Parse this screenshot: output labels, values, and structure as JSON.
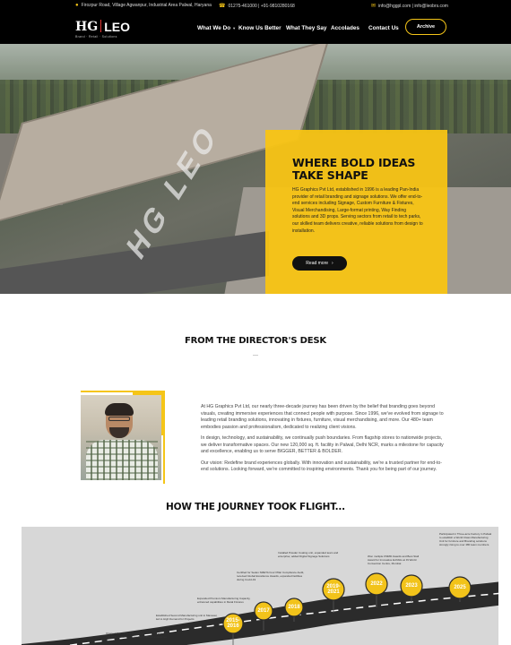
{
  "topbar": {
    "address": "Firozpur Road, Village Agwanpur, Industrial Area Palwal, Haryana",
    "phone": "01275-461000 | +91-9810280168",
    "email": "info@hggpl.com | info@leobrs.com"
  },
  "nav": {
    "logo_main": "HG",
    "logo_second": "LEO",
    "logo_tagline": "Brand · Retail · Solutions",
    "items": [
      {
        "label": "What We Do",
        "has_dropdown": true
      },
      {
        "label": "Know Us Better",
        "has_dropdown": false
      },
      {
        "label": "What They Say",
        "has_dropdown": false
      },
      {
        "label": "Accolades",
        "has_dropdown": false
      },
      {
        "label": "Contact Us",
        "has_dropdown": false
      }
    ],
    "archive_label": "Archive"
  },
  "hero": {
    "building_text": "HG LEO",
    "heading_line1": "WHERE BOLD IDEAS",
    "heading_line2": "TAKE SHAPE",
    "body": "HG Graphics Pvt Ltd, established in 1996 is a leading Pan-India provider of retail branding and signage solutions. We offer end-to-end services including Signage, Custom Furniture & Fixtures, Visual Merchandising, Large-format printing, Way Finding solutions and 3D props. Serving sectors from retail to tech parks, our skilled team delivers creative, reliable solutions from design to installation.",
    "cta_label": "Read more",
    "accent_color": "#f8c414"
  },
  "director": {
    "title": "FROM THE DIRECTOR'S DESK",
    "paragraphs": [
      "At HG Graphics Pvt Ltd, our nearly three-decade journey has been driven by the belief that branding goes beyond visuals, creating immersive experiences that connect people with purpose. Since 1996, we've evolved from signage to leading retail branding solutions, innovating in fixtures, furniture, visual merchandising, and more. Our 480+ team embodies passion and professionalism, dedicated to realizing client visions.",
      "In design, technology, and sustainability, we continually push boundaries. From flagship stores to nationwide projects, we deliver transformative spaces. Our new 120,000 sq. ft. facility in Palwal, Delhi NCR, marks a milestone for capacity and excellence, enabling us to serve BIGGER, BETTER & BOLDER.",
      "Our vision: Redefine brand experiences globally. With innovation and sustainability, we're a trusted partner for end-to-end solutions. Looking forward, we're committed to inspiring environments. Thank you for being part of our journey."
    ]
  },
  "journey": {
    "title": "HOW THE JOURNEY TOOK FLIGHT...",
    "milestones": [
      {
        "year_line1": "2015-",
        "year_line2": "2016",
        "note": "Opened Mumbai and Bangalore offices; received FMMD Retail Design Award and HBMM Excellence Award"
      },
      {
        "year_line1": "2017",
        "year_line2": "",
        "note": "Established Second Manufacturing unit in Manesar, led to High Demand for Projects"
      },
      {
        "year_line1": "2018",
        "year_line2": "",
        "note": "Expanded Premium Manufacturing Capacity, enhanced capabilities in Metal Fixtures"
      },
      {
        "year_line1": "2019-",
        "year_line2": "2021",
        "note": "Certified for Sedex SMETA Four Pillar Compliance Audit, received Global Excellence Awards, expanded facilities during Covid-19"
      },
      {
        "year_line1": "2022",
        "year_line2": "",
        "note": "Installed Powder Coating unit, expanded team and enterprise; added Digital Signage Solutions"
      },
      {
        "year_line1": "2023",
        "year_line2": "",
        "note": "Won multiple FMMD Awards and Best Stall Award for Innovative Exhibits at IN World Convention Centre, Mumbai"
      },
      {
        "year_line1": "2025",
        "year_line2": "",
        "note": "Participated in Three-acre Factory in Palwal to establish a World Class Manufacturing Unit for furniture and Branding solutions strongly rising to over 480 team members."
      }
    ]
  }
}
